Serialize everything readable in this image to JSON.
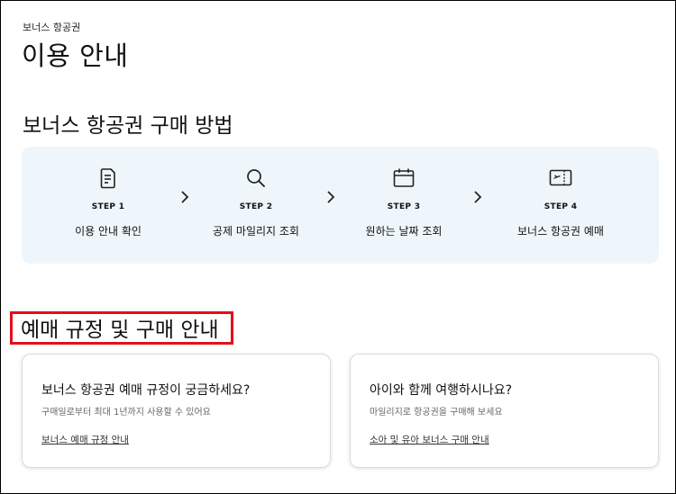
{
  "breadcrumb": "보너스 항공권",
  "page_title": "이용 안내",
  "purchase_section": {
    "title": "보너스 항공권 구매 방법",
    "steps": [
      {
        "number": "STEP 1",
        "label": "이용 안내 확인",
        "icon": "document-icon"
      },
      {
        "number": "STEP 2",
        "label": "공제 마일리지 조회",
        "icon": "search-icon"
      },
      {
        "number": "STEP 3",
        "label": "원하는 날짜 조회",
        "icon": "calendar-icon"
      },
      {
        "number": "STEP 4",
        "label": "보너스 항공권 예매",
        "icon": "ticket-icon"
      }
    ]
  },
  "rules_section": {
    "title": "예매 규정 및 구매 안내",
    "highlight_color": "#e3101c",
    "cards": [
      {
        "title": "보너스 항공권 예매 규정이 궁금하세요?",
        "description": "구매일로부터 최대 1년까지 사용할 수 있어요",
        "link": "보너스 예매 규정 안내"
      },
      {
        "title": "아이와 함께 여행하시나요?",
        "description": "마일리지로 항공권을 구매해 보세요",
        "link": "소아 및 유아 보너스 구매 안내"
      }
    ]
  },
  "colors": {
    "panel_bg": "#eef6fb",
    "text": "#111111"
  }
}
